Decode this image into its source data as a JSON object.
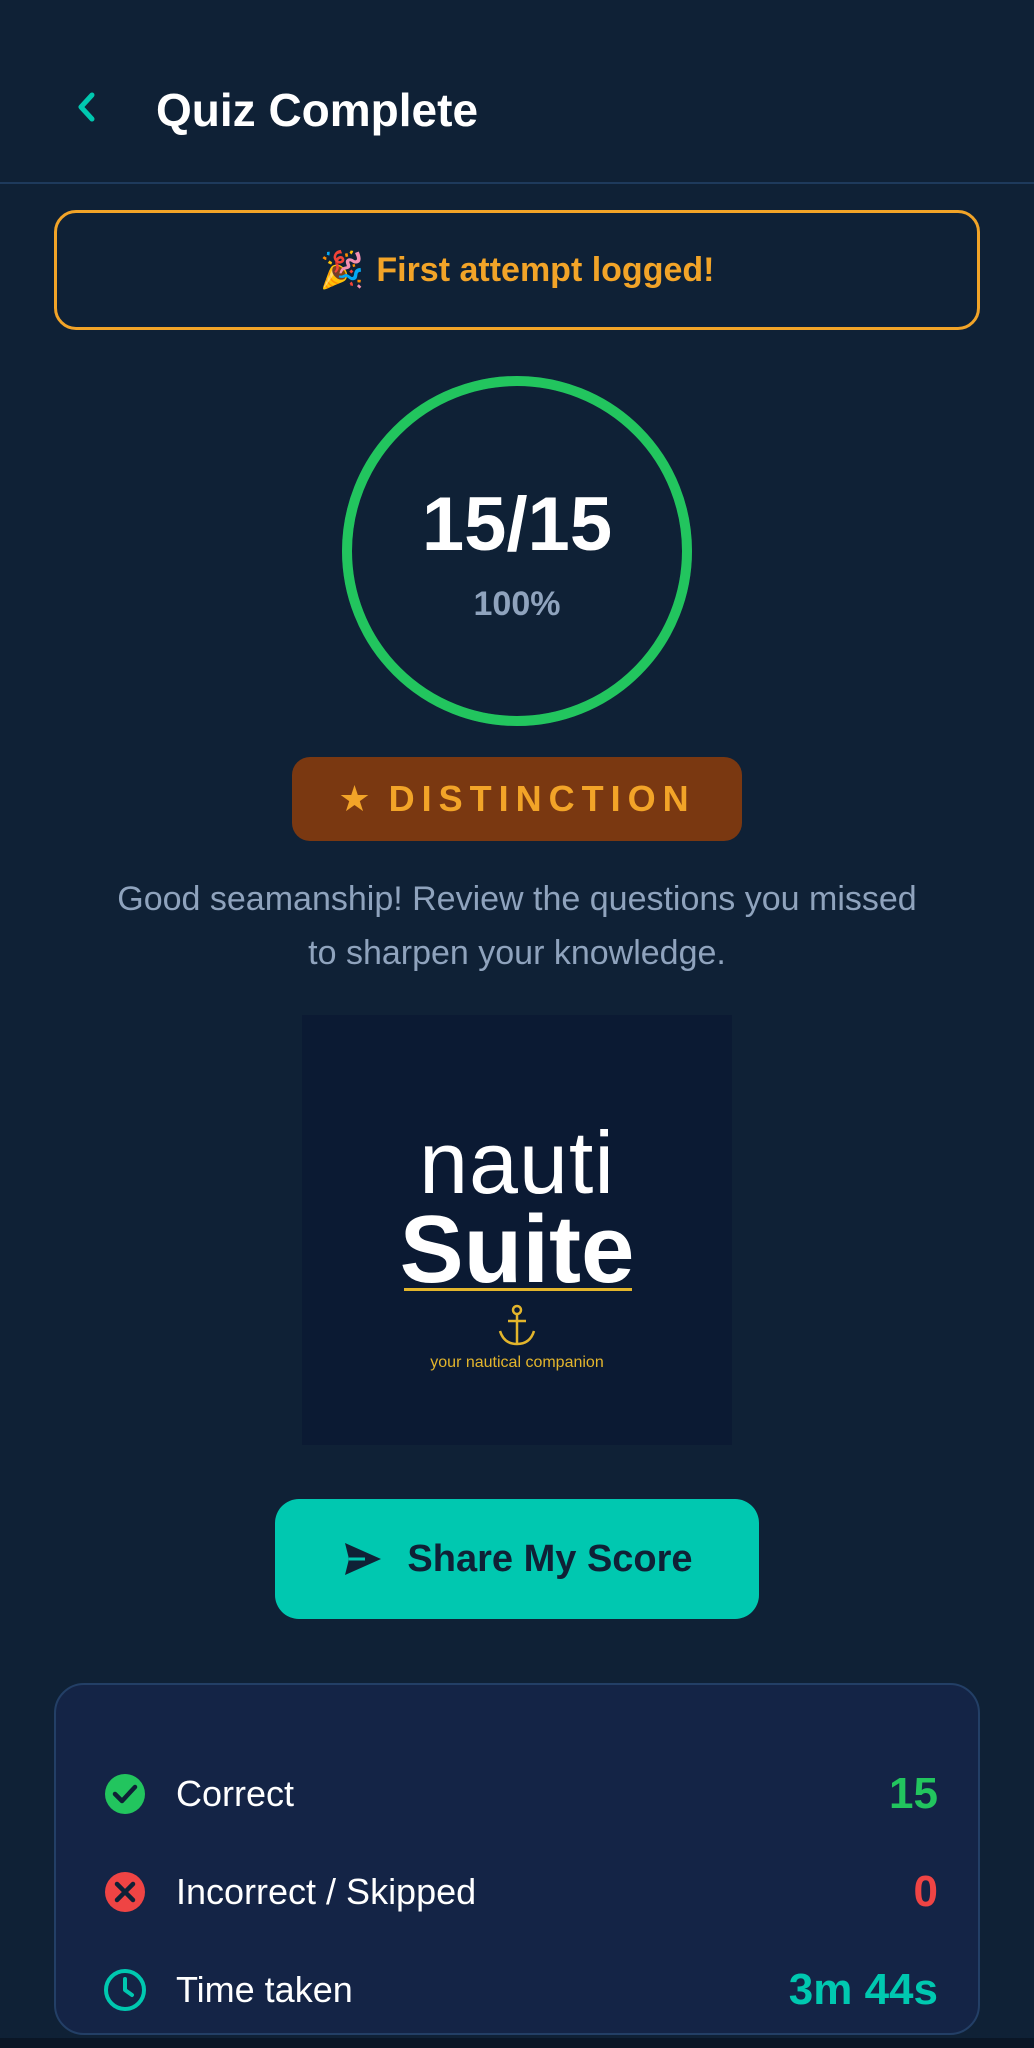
{
  "header": {
    "title": "Quiz Complete"
  },
  "banner": {
    "emoji": "🎉",
    "text": "First attempt logged!"
  },
  "score": {
    "correct": 15,
    "total": 15,
    "display": "15/15",
    "percent": "100%",
    "progress_fraction": 1.0
  },
  "badge": {
    "star": "★",
    "label": "DISTINCTION"
  },
  "message": "Good seamanship! Review the questions you missed to sharpen your knowledge.",
  "logo": {
    "line1": "nauti",
    "line2": "Suite",
    "tagline": "your nautical companion"
  },
  "share_button": {
    "label": "Share My Score"
  },
  "stats": {
    "correct": {
      "label": "Correct",
      "value": "15"
    },
    "incorrect": {
      "label": "Incorrect / Skipped",
      "value": "0"
    },
    "time": {
      "label": "Time taken",
      "value": "3m 44s"
    }
  },
  "colors": {
    "background": "#0f2136",
    "accent_teal": "#00c8b0",
    "success_green": "#22c55e",
    "error_red": "#ef4444",
    "gold": "#f2a428",
    "muted_text": "#8fa3bd"
  },
  "icons": {
    "back": "chevron-left-icon",
    "share": "send-icon",
    "correct": "check-circle-icon",
    "incorrect": "x-circle-icon",
    "time": "clock-icon",
    "logo": "anchor-icon"
  }
}
